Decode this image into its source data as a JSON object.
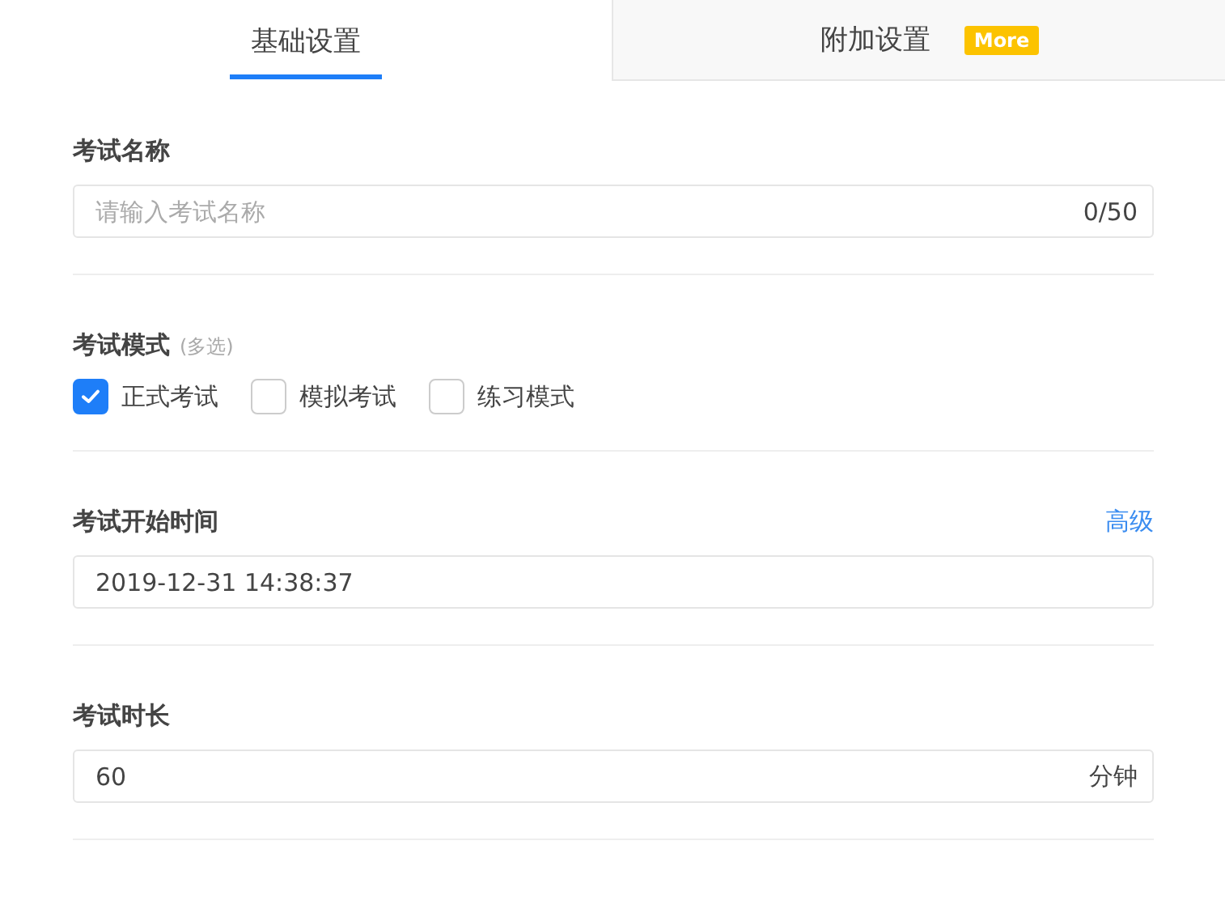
{
  "tabs": [
    {
      "label": "基础设置",
      "selected": true
    },
    {
      "label": "附加设置",
      "selected": false,
      "badge": "More"
    }
  ],
  "fields": [
    {
      "kind": "input",
      "label": "考试名称",
      "placeholder": "请输入考试名称",
      "suffix": "0/50"
    },
    {
      "kind": "checks",
      "label": "考试模式",
      "hint": "(多选)",
      "options": [
        {
          "label": "正式考试",
          "checked": true
        },
        {
          "label": "模拟考试",
          "checked": false
        },
        {
          "label": "练习模式",
          "checked": false
        }
      ]
    },
    {
      "kind": "input",
      "label": "考试开始时间",
      "link": "高级",
      "value": "2019-12-31 14:38:37"
    },
    {
      "kind": "input",
      "label": "考试时长",
      "value": "60",
      "suffix": "分钟"
    }
  ]
}
